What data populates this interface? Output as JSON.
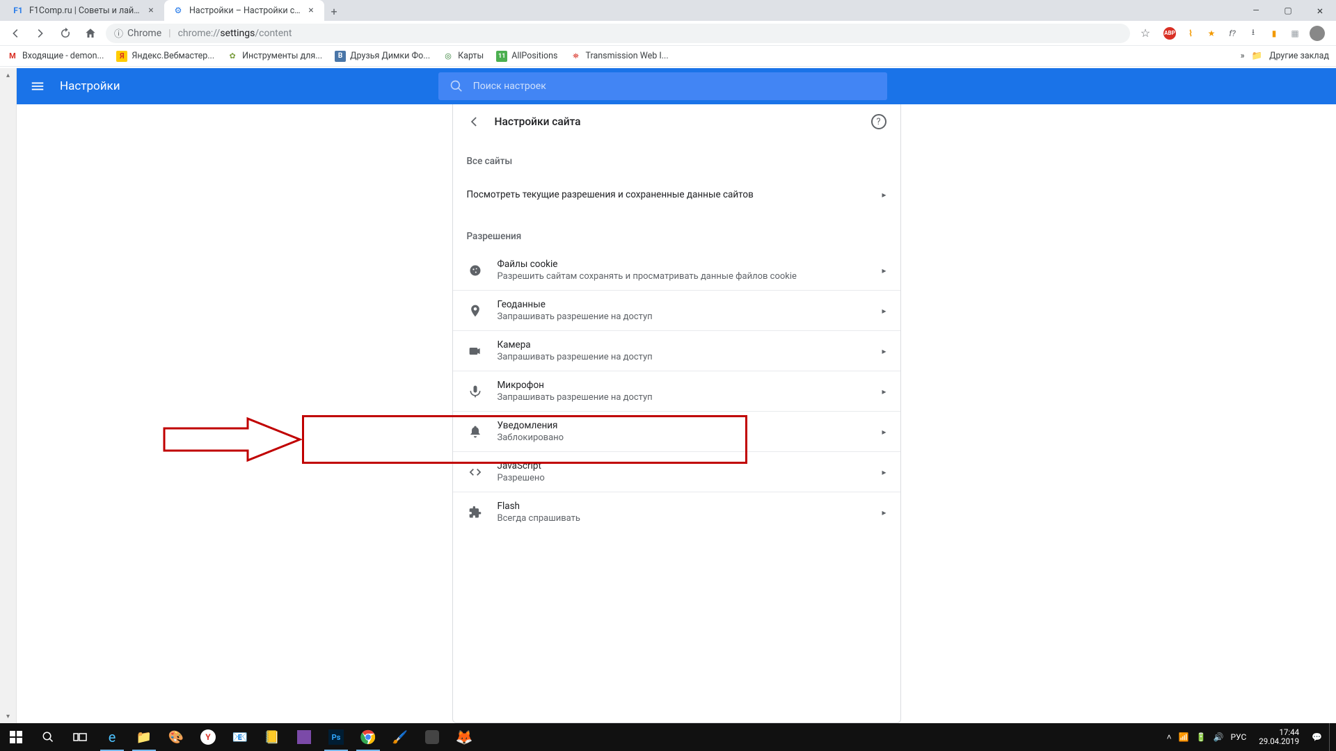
{
  "tabs": [
    {
      "favicon": "F1",
      "faviconColor": "#2b7de9",
      "label": "F1Comp.ru | Советы и лайфхаки",
      "active": false
    },
    {
      "favicon": "⚙",
      "faviconColor": "#1a73e8",
      "label": "Настройки – Настройки сайта",
      "active": true
    }
  ],
  "omnibox": {
    "chromePrefix": "Chrome",
    "url_dim1": "chrome://",
    "url_strong": "settings",
    "url_dim2": "/content"
  },
  "bookmarks": [
    {
      "iconText": "M",
      "iconBg": "#ffffff",
      "iconColor": "#d93025",
      "label": "Входящие - demon..."
    },
    {
      "iconText": "Я",
      "iconBg": "#ffcc00",
      "iconColor": "#d93025",
      "label": "Яндекс.Вебмастер..."
    },
    {
      "iconText": "✿",
      "iconBg": "#ffffff",
      "iconColor": "#7b9e3f",
      "label": "Инструменты для..."
    },
    {
      "iconText": "B",
      "iconBg": "#4a76a8",
      "iconColor": "#ffffff",
      "label": "Друзья Димки Фо..."
    },
    {
      "iconText": "◎",
      "iconBg": "#ffffff",
      "iconColor": "#2e7d32",
      "label": "Карты"
    },
    {
      "iconText": "11",
      "iconBg": "#4caf50",
      "iconColor": "#ffffff",
      "label": "AllPositions"
    },
    {
      "iconText": "⛯",
      "iconBg": "#ffffff",
      "iconColor": "#d93025",
      "label": "Transmission Web I..."
    }
  ],
  "bookmarks_more": "»",
  "bookmarks_other": "Другие заклад",
  "settings": {
    "title": "Настройки",
    "search_placeholder": "Поиск настроек",
    "page_title": "Настройки сайта",
    "all_sites_label": "Все сайты",
    "all_sites_row": "Посмотреть текущие разрешения и сохраненные данные сайтов",
    "permissions_label": "Разрешения",
    "permissions": [
      {
        "id": "cookies",
        "title": "Файлы cookie",
        "sub": "Разрешить сайтам сохранять и просматривать данные файлов cookie"
      },
      {
        "id": "location",
        "title": "Геоданные",
        "sub": "Запрашивать разрешение на доступ"
      },
      {
        "id": "camera",
        "title": "Камера",
        "sub": "Запрашивать разрешение на доступ"
      },
      {
        "id": "microphone",
        "title": "Микрофон",
        "sub": "Запрашивать разрешение на доступ"
      },
      {
        "id": "notifications",
        "title": "Уведомления",
        "sub": "Заблокировано"
      },
      {
        "id": "javascript",
        "title": "JavaScript",
        "sub": "Разрешено"
      },
      {
        "id": "flash",
        "title": "Flash",
        "sub": "Всегда спрашивать"
      }
    ]
  },
  "tray": {
    "lang": "РУС",
    "time": "17:44",
    "date": "29.04.2019"
  }
}
